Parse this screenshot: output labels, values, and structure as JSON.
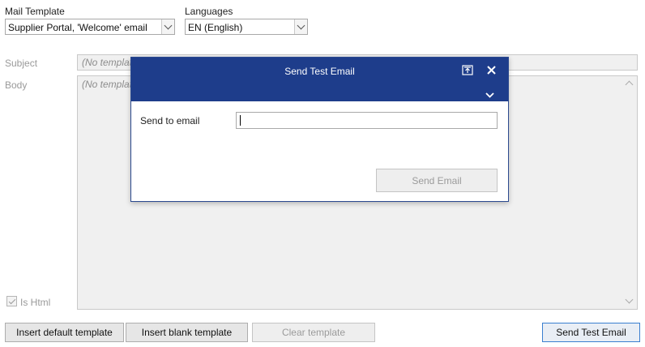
{
  "mail_template": {
    "label": "Mail Template",
    "selected": "Supplier Portal, 'Welcome' email"
  },
  "languages": {
    "label": "Languages",
    "selected": "EN (English)"
  },
  "subject": {
    "label": "Subject",
    "placeholder": "(No template"
  },
  "body": {
    "label": "Body",
    "placeholder": "(No template"
  },
  "is_html": {
    "label": "Is Html",
    "checked": true
  },
  "buttons": {
    "insert_default": "Insert default template",
    "insert_blank": "Insert blank template",
    "clear_template": "Clear template",
    "send_test_email": "Send Test Email"
  },
  "dialog": {
    "title": "Send Test Email",
    "send_to_label": "Send to email",
    "email_value": "",
    "send_button": "Send Email"
  },
  "icons": {
    "restore": "restore-window-icon",
    "close": "close-icon",
    "collapse": "chevron-down-icon"
  },
  "colors": {
    "dialog_header": "#1e3d8b",
    "primary_border": "#3a7fd0"
  }
}
